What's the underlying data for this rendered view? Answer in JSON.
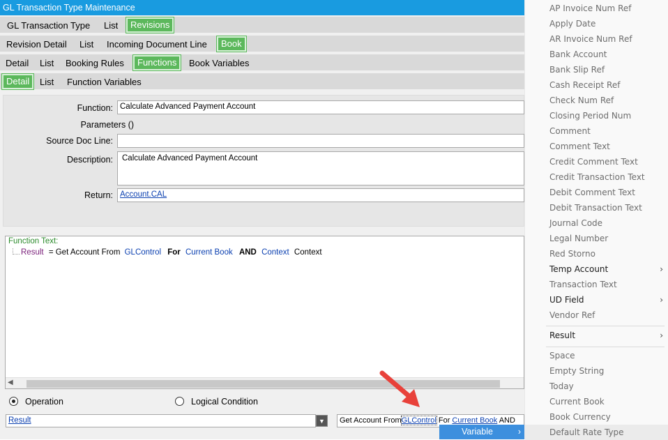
{
  "window": {
    "title": "GL Transaction Type Maintenance"
  },
  "tab_rows": [
    {
      "tabs": [
        "GL Transaction Type",
        "List",
        "Revisions"
      ],
      "active": "Revisions"
    },
    {
      "tabs": [
        "Revision Detail",
        "List",
        "Incoming Document Line",
        "Book"
      ],
      "active": "Book"
    },
    {
      "tabs": [
        "Detail",
        "List",
        "Booking Rules",
        "Functions",
        "Book Variables"
      ],
      "active": "Functions"
    },
    {
      "tabs": [
        "Detail",
        "List",
        "Function Variables"
      ],
      "active": "Detail"
    }
  ],
  "form": {
    "function_label": "Function:",
    "function_value": "Calculate Advanced Payment Account",
    "parameters_label": "Parameters ()",
    "source_doc_line_label": "Source Doc Line:",
    "source_doc_line_value": "",
    "description_label": "Description:",
    "description_value": "Calculate Advanced Payment Account",
    "return_label": "Return:",
    "return_value": "Account.CAL"
  },
  "function_text": {
    "header": "Function Text:",
    "tokens": [
      "Result",
      "= Get Account From",
      "GLControl",
      "For",
      "Current Book",
      "AND",
      "Context",
      "Context"
    ]
  },
  "colors": {
    "title_bar": "#199be0",
    "active_tab": "#5cb85c",
    "link": "#0a3fb0",
    "variable": "#7a1f7a",
    "menu_highlight": "#3c8fde"
  },
  "options": {
    "operation_label": "Operation",
    "logical_condition_label": "Logical Condition",
    "selected": "Operation"
  },
  "expression_bar": {
    "left_value": "Result",
    "right_prefix": "Get Account From",
    "right_link": "GLControl",
    "right_for": "For",
    "right_book": "Current Book",
    "right_and": "AND"
  },
  "context_menu": {
    "variable_label": "Variable",
    "items": [
      {
        "label": "AP Invoice Num Ref",
        "enabled": false
      },
      {
        "label": "Apply Date",
        "enabled": false
      },
      {
        "label": "AR Invoice Num Ref",
        "enabled": false
      },
      {
        "label": "Bank Account",
        "enabled": false
      },
      {
        "label": "Bank Slip Ref",
        "enabled": false
      },
      {
        "label": "Cash Receipt Ref",
        "enabled": false
      },
      {
        "label": "Check Num Ref",
        "enabled": false
      },
      {
        "label": "Closing Period Num",
        "enabled": false
      },
      {
        "label": "Comment",
        "enabled": false
      },
      {
        "label": "Comment Text",
        "enabled": false
      },
      {
        "label": "Credit Comment Text",
        "enabled": false
      },
      {
        "label": "Credit Transaction Text",
        "enabled": false
      },
      {
        "label": "Debit Comment Text",
        "enabled": false
      },
      {
        "label": "Debit Transaction Text",
        "enabled": false
      },
      {
        "label": "Journal Code",
        "enabled": false
      },
      {
        "label": "Legal Number",
        "enabled": false
      },
      {
        "label": "Red Storno",
        "enabled": false
      },
      {
        "label": "Temp Account",
        "enabled": true,
        "submenu": true
      },
      {
        "label": "Transaction Text",
        "enabled": false
      },
      {
        "label": "UD Field",
        "enabled": true,
        "submenu": true
      },
      {
        "label": "Vendor Ref",
        "enabled": false
      },
      {
        "label": "Result",
        "enabled": true,
        "submenu": true
      },
      {
        "label": "Space",
        "enabled": false
      },
      {
        "label": "Empty String",
        "enabled": false
      },
      {
        "label": "Today",
        "enabled": false
      },
      {
        "label": "Current Book",
        "enabled": false
      },
      {
        "label": "Book Currency",
        "enabled": false
      },
      {
        "label": "Default Rate Type",
        "enabled": false
      }
    ]
  }
}
